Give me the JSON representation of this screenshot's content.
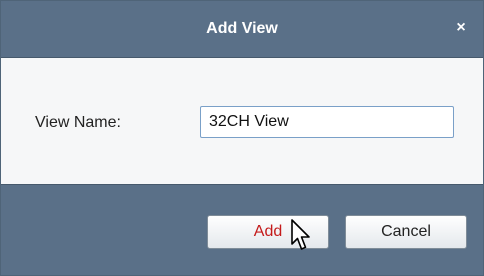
{
  "dialog": {
    "title": "Add View",
    "close_icon": "close-icon",
    "close_glyph": "×"
  },
  "form": {
    "name_label": "View Name:",
    "name_value": "32CH View"
  },
  "buttons": {
    "add_label": "Add",
    "cancel_label": "Cancel"
  },
  "colors": {
    "title_bar": "#5a7088",
    "add_text": "#c41a1a"
  },
  "icons": {
    "cursor": "mouse-pointer-icon"
  }
}
